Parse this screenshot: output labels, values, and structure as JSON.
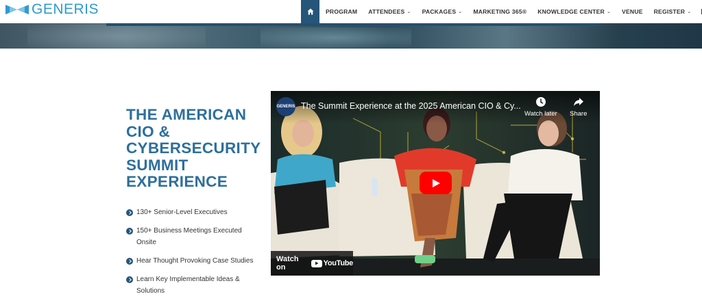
{
  "brand": {
    "name": "GENERIS",
    "color": "#2f9ad0"
  },
  "nav": {
    "home_icon": "home-icon",
    "items": [
      {
        "label": "PROGRAM",
        "dropdown": false
      },
      {
        "label": "ATTENDEES",
        "dropdown": true
      },
      {
        "label": "PACKAGES",
        "dropdown": true
      },
      {
        "label": "MARKETING 365®",
        "dropdown": false
      },
      {
        "label": "KNOWLEDGE CENTER",
        "dropdown": true
      },
      {
        "label": "VENUE",
        "dropdown": false
      },
      {
        "label": "REGISTER",
        "dropdown": true
      }
    ],
    "mail_icon": "mail-icon",
    "accent": "#26557a"
  },
  "section": {
    "title": "THE AMERICAN CIO & CYBERSECURITY SUMMIT EXPERIENCE",
    "title_color": "#2d6f9d",
    "bullets": [
      "130+ Senior-Level Executives",
      "150+ Business Meetings Executed Onsite",
      "Hear Thought Provoking Case Studies",
      "Learn Key Implementable Ideas & Solutions"
    ]
  },
  "video": {
    "channel_label": "GENERIS",
    "title": "The Summit Experience at the 2025 American CIO & Cy...",
    "watch_later": "Watch later",
    "share": "Share",
    "watch_on": "Watch on",
    "platform": "YouTube",
    "play_color": "#ff0000"
  }
}
